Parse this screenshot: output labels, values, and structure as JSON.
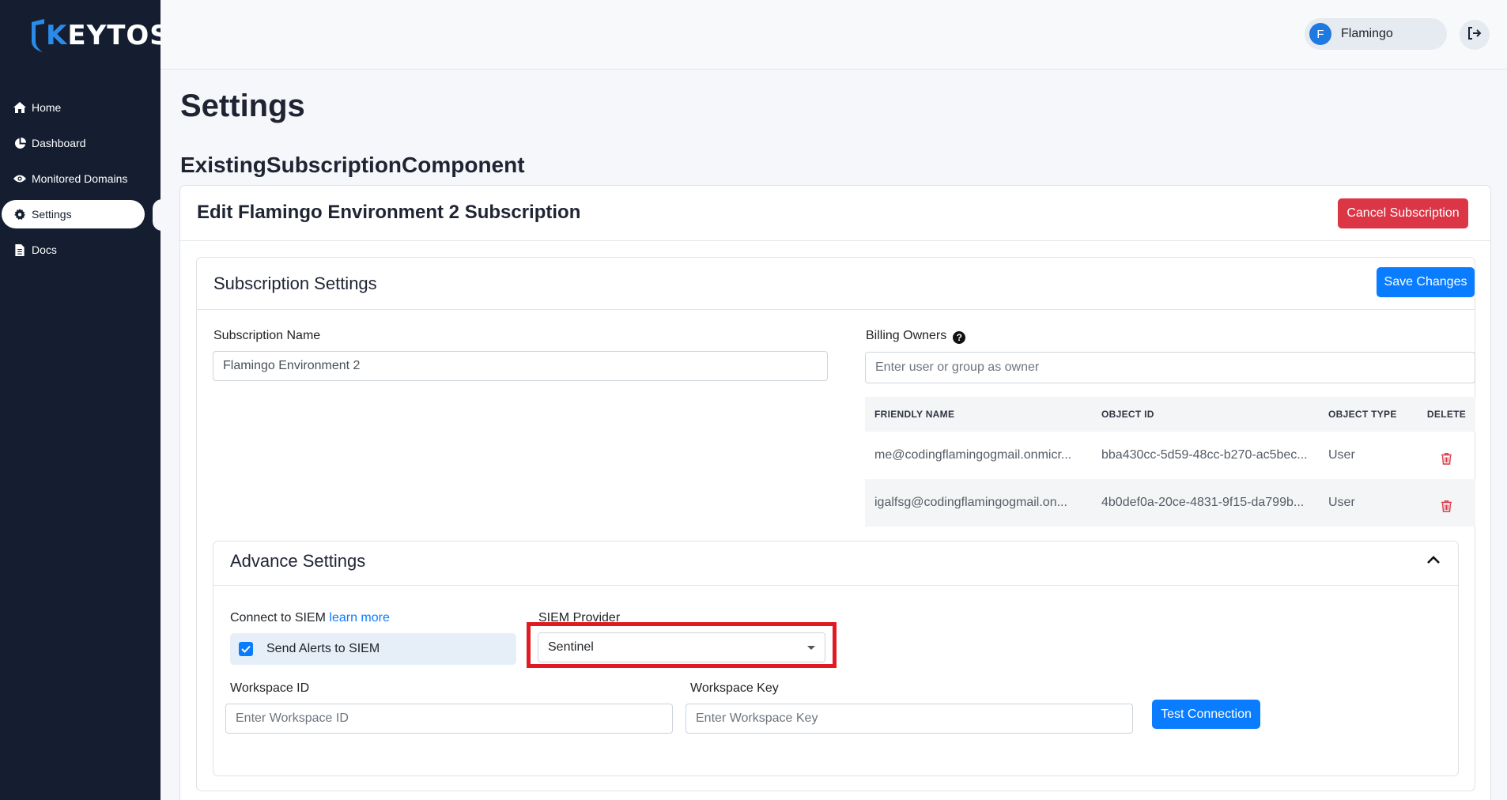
{
  "brand": {
    "logo_text_accent": "K",
    "logo_text_rest": "EYTOS"
  },
  "sidebar": {
    "items": [
      {
        "label": "Home",
        "icon": "home-icon"
      },
      {
        "label": "Dashboard",
        "icon": "pie-chart-icon"
      },
      {
        "label": "Monitored Domains",
        "icon": "eye-icon"
      },
      {
        "label": "Settings",
        "icon": "gear-icon",
        "active": true
      },
      {
        "label": "Docs",
        "icon": "document-icon"
      }
    ]
  },
  "topbar": {
    "user_initial": "F",
    "user_name": "Flamingo",
    "logout_icon": "logout-icon"
  },
  "page": {
    "title": "Settings",
    "component_title": "ExistingSubscriptionComponent"
  },
  "edit": {
    "title": "Edit Flamingo Environment 2 Subscription",
    "cancel_label": "Cancel Subscription"
  },
  "subscription_settings": {
    "title": "Subscription Settings",
    "save_label": "Save Changes",
    "name_label": "Subscription Name",
    "name_value": "Flamingo Environment 2",
    "billing_label": "Billing Owners",
    "billing_placeholder": "Enter user or group as owner",
    "table": {
      "headers": [
        "FRIENDLY NAME",
        "OBJECT ID",
        "OBJECT TYPE",
        "DELETE"
      ],
      "rows": [
        {
          "friendly_name": "me@codingflamingogmail.onmicr...",
          "object_id": "bba430cc-5d59-48cc-b270-ac5bec...",
          "object_type": "User"
        },
        {
          "friendly_name": "igalfsg@codingflamingogmail.on...",
          "object_id": "4b0def0a-20ce-4831-9f15-da799b...",
          "object_type": "User"
        }
      ]
    }
  },
  "advance_settings": {
    "title": "Advance Settings",
    "connect_label": "Connect to SIEM",
    "learn_more": "learn more",
    "send_alerts_label": "Send Alerts to SIEM",
    "send_alerts_checked": true,
    "siem_provider_label": "SIEM Provider",
    "siem_provider_value": "Sentinel",
    "workspace_id_label": "Workspace ID",
    "workspace_id_placeholder": "Enter Workspace ID",
    "workspace_key_label": "Workspace Key",
    "workspace_key_placeholder": "Enter Workspace Key",
    "test_label": "Test Connection"
  },
  "colors": {
    "sidebar_bg": "#141e30",
    "primary": "#0a7cff",
    "danger": "#dc3545",
    "highlight": "#e01a22"
  }
}
